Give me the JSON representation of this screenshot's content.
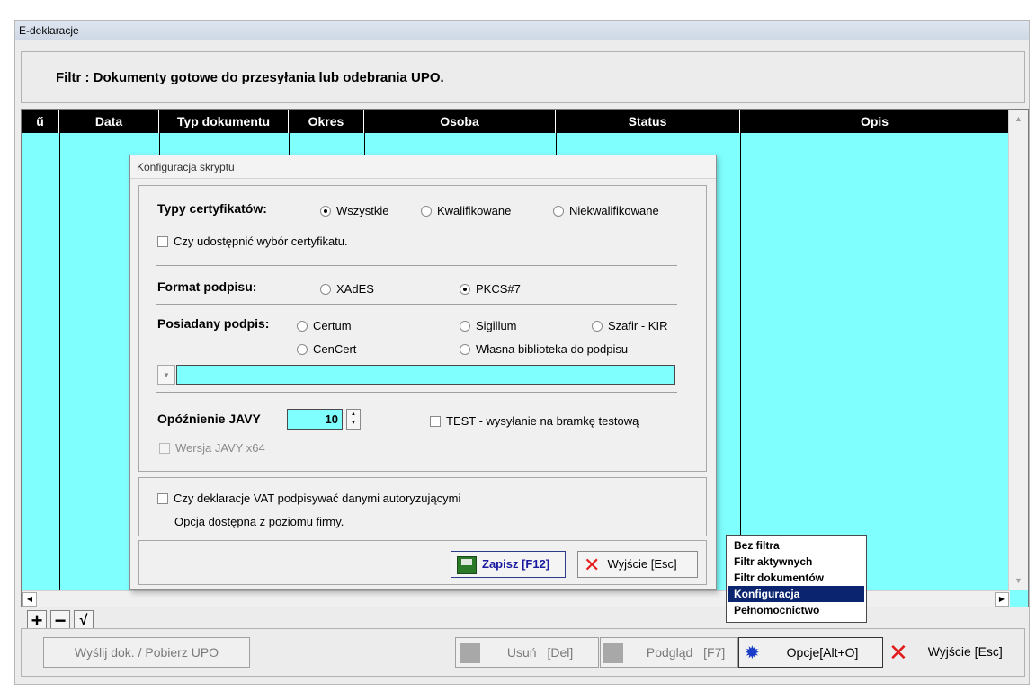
{
  "window": {
    "title": "E-deklaracje"
  },
  "filter": {
    "text": "Filtr : Dokumenty gotowe do przesyłania lub odebrania UPO."
  },
  "grid": {
    "columns": [
      "ű",
      "Data",
      "Typ dokumentu",
      "Okres",
      "Osoba",
      "Status",
      "Opis"
    ]
  },
  "dialog": {
    "title": "Konfiguracja skryptu",
    "cert_types": {
      "label": "Typy certyfikatów:",
      "options": [
        "Wszystkie",
        "Kwalifikowane",
        "Niekwalifikowane"
      ],
      "selected": "Wszystkie"
    },
    "share_cert_choice": "Czy udostępnić wybór certyfikatu.",
    "signature_format": {
      "label": "Format podpisu:",
      "options": [
        "XAdES",
        "PKCS#7"
      ],
      "selected": "PKCS#7"
    },
    "owned_signature": {
      "label": "Posiadany podpis:",
      "options": [
        "Certum",
        "Sigillum",
        "Szafir - KIR",
        "CenCert",
        "Własna biblioteka do podpisu"
      ]
    },
    "java_delay": {
      "label": "Opóźnienie JAVY",
      "value": "10"
    },
    "test_send": "TEST - wysyłanie na bramkę testową",
    "java_x64": "Wersja JAVY x64",
    "vat_sign": "Czy deklaracje VAT podpisywać danymi autoryzującymi",
    "company_note": "Opcja dostępna z poziomu firmy.",
    "save_label": "Zapisz  [F12]",
    "exit_label": "Wyjście  [Esc]"
  },
  "menu": {
    "items": [
      "Bez filtra",
      "Filtr aktywnych",
      "Filtr dokumentów",
      "Konfiguracja",
      "Pełnomocnictwo"
    ],
    "selected": "Konfiguracja"
  },
  "toolbar": {
    "send_label": "Wyślij dok. / Pobierz UPO",
    "delete_label": "Usuń",
    "delete_key": "[Del]",
    "preview_label": "Podgląd",
    "preview_key": "[F7]",
    "options_label": "Opcje[Alt+O]",
    "exit_label": "Wyjście  [Esc]"
  }
}
